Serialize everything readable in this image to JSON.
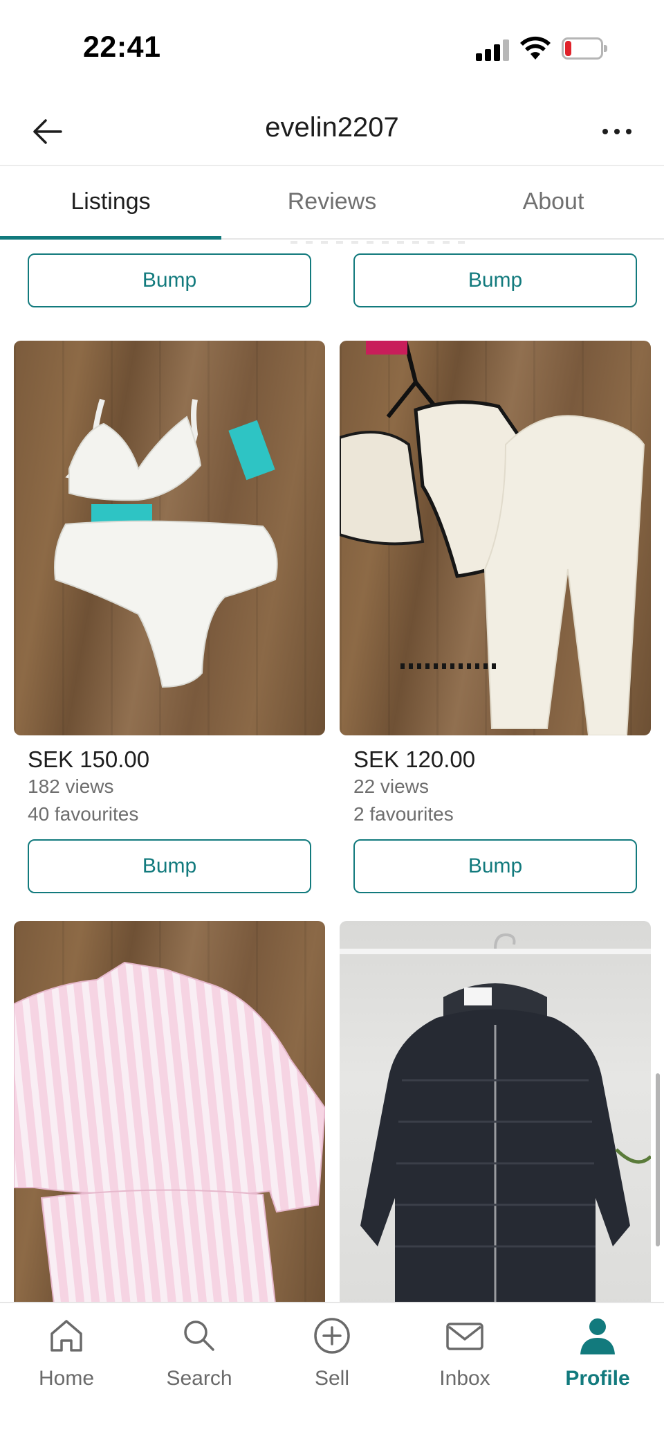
{
  "status_bar": {
    "time": "22:41"
  },
  "header": {
    "username": "evelin2207"
  },
  "tabs": [
    {
      "label": "Listings"
    },
    {
      "label": "Reviews"
    },
    {
      "label": "About"
    }
  ],
  "top_row": {
    "bump_left": "Bump",
    "bump_right": "Bump"
  },
  "listings": [
    {
      "price": "SEK 150.00",
      "views": "182 views",
      "favourites": "40 favourites",
      "bump": "Bump",
      "image": "white-bikini-set"
    },
    {
      "price": "SEK 120.00",
      "views": "22 views",
      "favourites": "2 favourites",
      "bump": "Bump",
      "image": "cream-pajama-set"
    },
    {
      "image": "pink-striped-pajamas"
    },
    {
      "image": "black-puffer-jacket"
    }
  ],
  "bottom_nav": [
    {
      "label": "Home",
      "icon": "home-icon"
    },
    {
      "label": "Search",
      "icon": "search-icon"
    },
    {
      "label": "Sell",
      "icon": "plus-circle-icon"
    },
    {
      "label": "Inbox",
      "icon": "mail-icon"
    },
    {
      "label": "Profile",
      "icon": "profile-icon",
      "active": true
    }
  ],
  "colors": {
    "accent": "#127a7d",
    "battery_low": "#e0232b"
  }
}
